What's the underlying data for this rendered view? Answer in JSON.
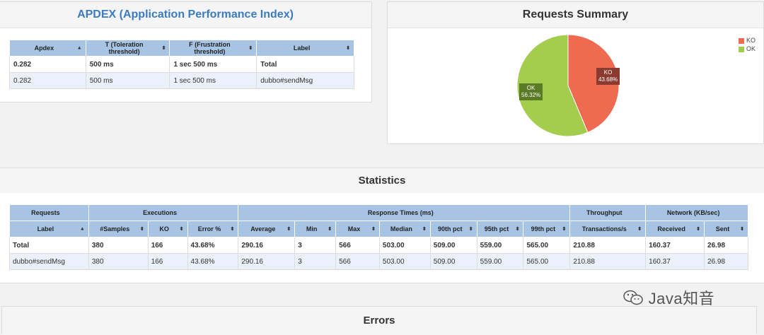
{
  "apdex": {
    "title": "APDEX (Application Performance Index)",
    "headers": [
      "Apdex",
      "T (Toleration threshold)",
      "F (Frustration threshold)",
      "Label"
    ],
    "rows": [
      [
        "0.282",
        "500 ms",
        "1 sec 500 ms",
        "Total"
      ],
      [
        "0.282",
        "500 ms",
        "1 sec 500 ms",
        "dubbo#sendMsg"
      ]
    ]
  },
  "summary": {
    "title": "Requests Summary",
    "legend": [
      {
        "label": "KO",
        "color": "#ee6a50"
      },
      {
        "label": "OK",
        "color": "#a4cc4d"
      }
    ],
    "ko_label": "KO",
    "ko_pct": "43.68%",
    "ok_label": "OK",
    "ok_pct": "56.32%"
  },
  "chart_data": {
    "type": "pie",
    "title": "Requests Summary",
    "categories": [
      "KO",
      "OK"
    ],
    "values": [
      43.68,
      56.32
    ],
    "colors": [
      "#ee6a50",
      "#a4cc4d"
    ],
    "legend": "top-right"
  },
  "statistics": {
    "title": "Statistics",
    "groups": [
      "Requests",
      "Executions",
      "Response Times (ms)",
      "Throughput",
      "Network (KB/sec)"
    ],
    "headers": [
      "Label",
      "#Samples",
      "KO",
      "Error %",
      "Average",
      "Min",
      "Max",
      "Median",
      "90th pct",
      "95th pct",
      "99th pct",
      "Transactions/s",
      "Received",
      "Sent"
    ],
    "rows": [
      [
        "Total",
        "380",
        "166",
        "43.68%",
        "290.16",
        "3",
        "566",
        "503.00",
        "509.00",
        "559.00",
        "565.00",
        "210.88",
        "160.37",
        "26.98"
      ],
      [
        "dubbo#sendMsg",
        "380",
        "166",
        "43.68%",
        "290.16",
        "3",
        "566",
        "503.00",
        "509.00",
        "559.00",
        "565.00",
        "210.88",
        "160.37",
        "26.98"
      ]
    ]
  },
  "errors": {
    "title": "Errors"
  },
  "watermark": {
    "text": "Java知音"
  },
  "icons": {
    "sort_asc": "▲",
    "sort_both": "⬍"
  }
}
